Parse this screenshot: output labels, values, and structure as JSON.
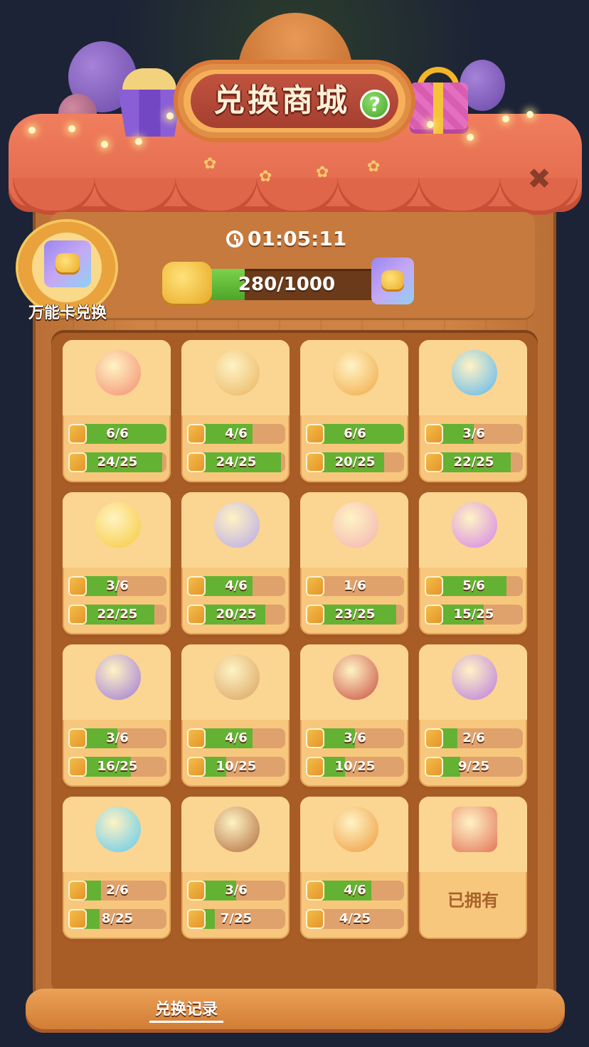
{
  "title": "兑换商城",
  "help_symbol": "?",
  "close_symbol": "✖",
  "timer": "01:05:11",
  "wildcard": {
    "label": "万能卡兑换",
    "icon": "wildcard-puzzle-icon"
  },
  "progress": {
    "text": "280/1000",
    "current": 280,
    "max": 1000
  },
  "colors": {
    "accent_green": "#64b233",
    "card_bg": "#f7c77d",
    "roof_red": "#e0664a"
  },
  "items": [
    {
      "art": "lucky-cat-fox",
      "art_color": "#f38c6e",
      "pieces": "6/6",
      "piece_frac": 1.0,
      "cards": "24/25",
      "card_frac": 0.96
    },
    {
      "art": "sailor-frame",
      "art_color": "#e9b35f",
      "pieces": "4/6",
      "piece_frac": 0.67,
      "cards": "24/25",
      "card_frac": 0.96
    },
    {
      "art": "ring-frame",
      "art_color": "#f0a742",
      "pieces": "6/6",
      "piece_frac": 1.0,
      "cards": "20/25",
      "card_frac": 0.8
    },
    {
      "art": "pink-fish-avatar",
      "art_color": "#5ab6f0",
      "pieces": "3/6",
      "piece_frac": 0.5,
      "cards": "22/25",
      "card_frac": 0.88
    },
    {
      "art": "chick-avatar",
      "art_color": "#f6c93a",
      "pieces": "3/6",
      "piece_frac": 0.5,
      "cards": "22/25",
      "card_frac": 0.88
    },
    {
      "art": "crystal-frame",
      "art_color": "#b9a8e8",
      "pieces": "4/6",
      "piece_frac": 0.67,
      "cards": "20/25",
      "card_frac": 0.8
    },
    {
      "art": "hi-bubble-pink",
      "art_color": "#f3b2b2",
      "pieces": "1/6",
      "piece_frac": 0.17,
      "cards": "23/25",
      "card_frac": 0.92
    },
    {
      "art": "heart-potion",
      "art_color": "#d483e8",
      "pieces": "5/6",
      "piece_frac": 0.83,
      "cards": "15/25",
      "card_frac": 0.6
    },
    {
      "art": "chick-cupcake",
      "art_color": "#9d7ad8",
      "pieces": "3/6",
      "piece_frac": 0.5,
      "cards": "16/25",
      "card_frac": 0.64
    },
    {
      "art": "flower-frame",
      "art_color": "#d9a15d",
      "pieces": "4/6",
      "piece_frac": 0.67,
      "cards": "10/25",
      "card_frac": 0.4
    },
    {
      "art": "hi-bubble-red",
      "art_color": "#c94d3f",
      "pieces": "3/6",
      "piece_frac": 0.5,
      "cards": "10/25",
      "card_frac": 0.4
    },
    {
      "art": "party-frame",
      "art_color": "#b97be0",
      "pieces": "2/6",
      "piece_frac": 0.33,
      "cards": "9/25",
      "card_frac": 0.36
    },
    {
      "art": "blue-ghost",
      "art_color": "#5cc9ee",
      "pieces": "2/6",
      "piece_frac": 0.33,
      "cards": "8/25",
      "card_frac": 0.32
    },
    {
      "art": "bear-avatar",
      "art_color": "#b06a3a",
      "pieces": "3/6",
      "piece_frac": 0.5,
      "cards": "7/25",
      "card_frac": 0.28
    },
    {
      "art": "pumpkin-frame",
      "art_color": "#ee9a3c",
      "pieces": "4/6",
      "piece_frac": 0.67,
      "cards": "4/25",
      "card_frac": 0.16
    },
    {
      "art": "fox-girl-avatar",
      "art_color": "#e3745a",
      "owned": true,
      "owned_label": "已拥有"
    }
  ],
  "footer": {
    "link": "兑换记录"
  }
}
